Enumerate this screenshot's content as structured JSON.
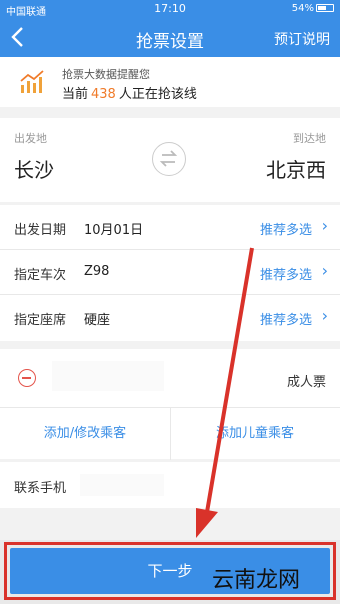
{
  "status_bar": {
    "carrier": "中国联通",
    "time": "17:10",
    "battery": "54%"
  },
  "nav": {
    "back_icon": "chevron-left-icon",
    "title": "抢票设置",
    "right_link": "预订说明"
  },
  "notice": {
    "icon": "bar-chart-icon",
    "line1": "抢票大数据提醒您",
    "line2_prefix": "当前",
    "count": "438",
    "line2_suffix": "人正在抢该线"
  },
  "route": {
    "from_label": "出发地",
    "from_city": "长沙",
    "to_label": "到达地",
    "to_city": "北京西",
    "swap_icon": "swap-icon"
  },
  "options": [
    {
      "label": "出发日期",
      "value": "10月01日",
      "link": "推荐多选"
    },
    {
      "label": "指定车次",
      "value": "Z98",
      "link": "推荐多选"
    },
    {
      "label": "指定座席",
      "value": "硬座",
      "link": "推荐多选"
    }
  ],
  "passenger": {
    "remove_icon": "minus-circle-icon",
    "type": "成人票",
    "add_modify": "添加/修改乘客",
    "add_child": "添加儿童乘客"
  },
  "contact": {
    "label": "联系手机"
  },
  "footer": {
    "next_label": "下一步"
  },
  "watermark": "云南龙网",
  "colors": {
    "primary": "#3a8ee6",
    "accent": "#f07b2a",
    "annotation": "#d9322a"
  }
}
